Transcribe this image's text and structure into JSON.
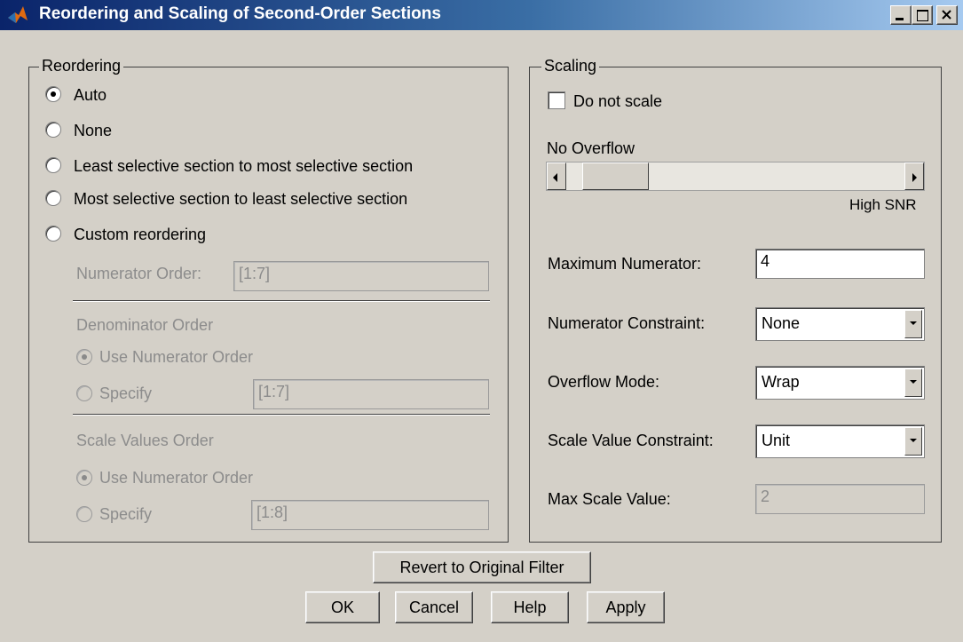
{
  "window": {
    "title": "Reordering and Scaling of Second-Order Sections",
    "icon": "matlab-logo-icon",
    "controls": [
      "minimize-icon",
      "maximize-icon",
      "close-icon"
    ]
  },
  "reordering": {
    "group_label": "Reordering",
    "options": [
      {
        "label": "Auto",
        "selected": true
      },
      {
        "label": "None",
        "selected": false
      },
      {
        "label": "Least selective section to most selective section",
        "selected": false
      },
      {
        "label": "Most selective section to least selective section",
        "selected": false
      },
      {
        "label": "Custom reordering",
        "selected": false
      }
    ],
    "numerator_order": {
      "label": "Numerator Order:",
      "value": "[1:7]"
    },
    "denominator_order": {
      "title": "Denominator Order",
      "use_label": "Use Numerator Order",
      "specify_label": "Specify",
      "value": "[1:7]"
    },
    "scale_values_order": {
      "title": "Scale Values Order",
      "use_label": "Use Numerator Order",
      "specify_label": "Specify",
      "value": "[1:8]"
    }
  },
  "scaling": {
    "group_label": "Scaling",
    "do_not_scale_label": "Do not scale",
    "do_not_scale_checked": false,
    "slider_min_label": "No Overflow",
    "slider_max_label": "High SNR",
    "slider_value": 0.06,
    "max_numerator": {
      "label": "Maximum Numerator:",
      "value": "4"
    },
    "numerator_constraint": {
      "label": "Numerator Constraint:",
      "value": "None"
    },
    "overflow_mode": {
      "label": "Overflow Mode:",
      "value": "Wrap"
    },
    "scale_value_constraint": {
      "label": "Scale Value Constraint:",
      "value": "Unit"
    },
    "max_scale_value": {
      "label": "Max Scale Value:",
      "value": "2"
    }
  },
  "buttons": {
    "revert": "Revert to Original Filter",
    "ok": "OK",
    "cancel": "Cancel",
    "help": "Help",
    "apply": "Apply"
  }
}
